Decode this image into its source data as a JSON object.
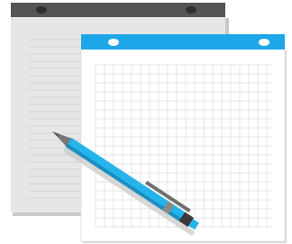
{
  "illustration": {
    "colors": {
      "background": "#ffffff",
      "lined_pad_header": "#555555",
      "lined_pad_sheet": "#e6e6e6",
      "lined_pad_shadow": "#c9c9c9",
      "ruled_line": "#d2d2d2",
      "grid_pad_header": "#1ea7e8",
      "grid_pad_sheet": "#ffffff",
      "grid_line": "#e4e4e4",
      "binding_hole": "#ffffff",
      "lined_binding_hole": "#2f2f2f",
      "pen_body": "#25b4ea",
      "pen_shadow": "#1a8fc0",
      "pen_metal": "#8a8a8a",
      "pen_tip": "#555555"
    },
    "objects": [
      {
        "name": "lined-notepad",
        "icon": "lined-notepad-icon"
      },
      {
        "name": "grid-notepad",
        "icon": "grid-notepad-icon"
      },
      {
        "name": "pen",
        "icon": "pen-icon"
      }
    ]
  }
}
